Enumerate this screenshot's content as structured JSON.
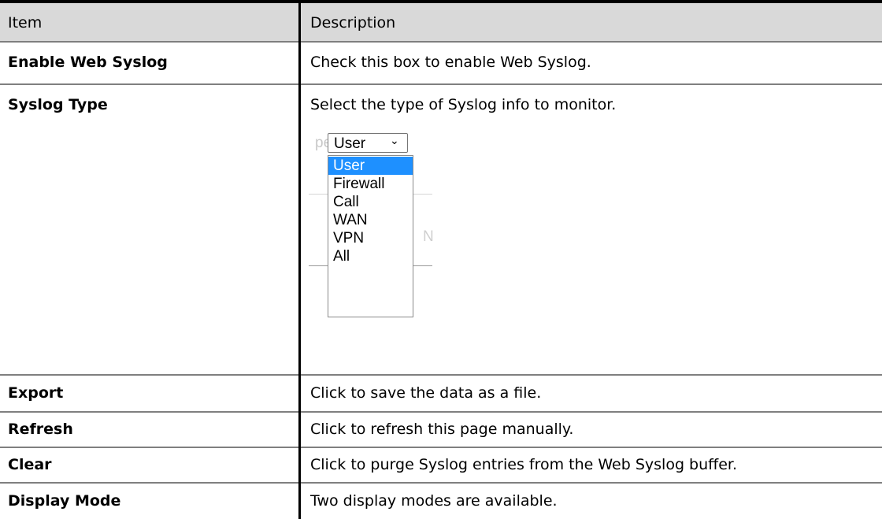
{
  "table": {
    "header": {
      "item": "Item",
      "description": "Description"
    },
    "rows": [
      {
        "item": "Enable Web Syslog",
        "description": "Check this box to enable Web Syslog."
      },
      {
        "item": "Syslog Type",
        "description": "Select the type of Syslog info to monitor."
      },
      {
        "item": "Export",
        "description": "Click to save the data as a file."
      },
      {
        "item": "Refresh",
        "description": "Click to refresh this page manually."
      },
      {
        "item": "Clear",
        "description": "Click to purge Syslog entries from the Web Syslog buffer."
      },
      {
        "item": "Display Mode",
        "description": "Two display modes are available."
      }
    ]
  },
  "syslog_dropdown": {
    "fragment_left": "pe",
    "fragment_right": "N",
    "selected": "User",
    "chevron_icon": "chevron-down-icon",
    "options": [
      "User",
      "Firewall",
      "Call",
      "WAN",
      "VPN",
      "All"
    ],
    "highlighted_option": "User",
    "highlight_color": "#1e90ff"
  }
}
